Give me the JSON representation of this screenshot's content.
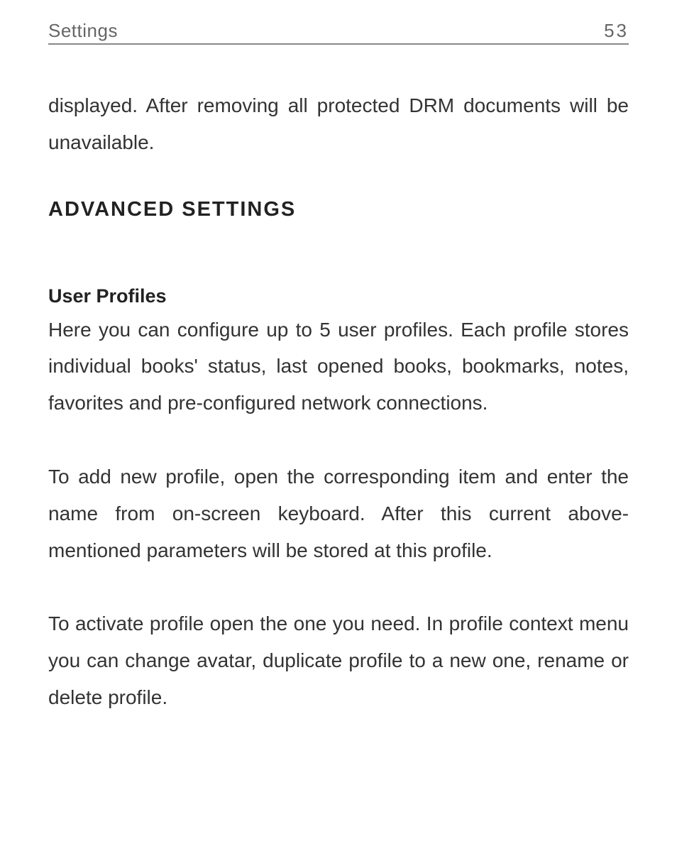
{
  "header": {
    "section": "Settings",
    "page_number": "53"
  },
  "content": {
    "lead_paragraph": "displayed. After removing all protected DRM documents will be unavailable.",
    "section_heading": "ADVANCED SETTINGS",
    "subsection_heading": "User Profiles",
    "paragraph_1": "Here you can configure up to 5 user profiles. Each profile stores individual books' status, last opened books, bookmarks, notes, favorites and pre-configured network connections.",
    "paragraph_2": "To add new profile, open the corresponding item and enter the name from on-screen keyboard. After this current above-mentioned parameters will be stored at this profile.",
    "paragraph_3": "To activate profile open the one you need. In profile context menu you can change avatar, duplicate profile to a new one, rename or delete profile."
  }
}
